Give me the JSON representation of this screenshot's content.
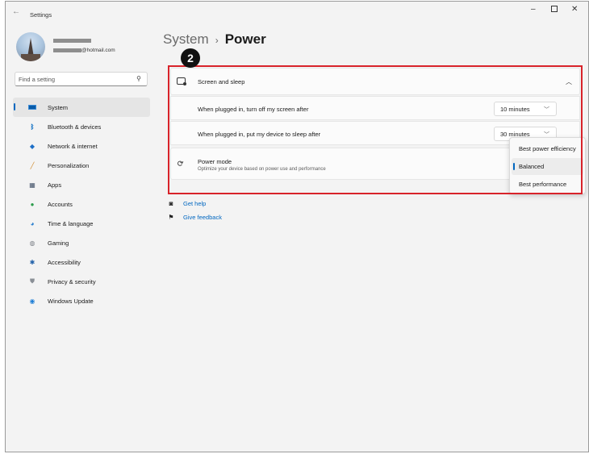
{
  "window": {
    "title": "Settings"
  },
  "user": {
    "email_suffix": "@hotmail.com"
  },
  "search": {
    "placeholder": "Find a setting"
  },
  "nav": [
    {
      "label": "System",
      "icon": "monitor-icon",
      "active": true
    },
    {
      "label": "Bluetooth & devices",
      "icon": "bluetooth-icon"
    },
    {
      "label": "Network & internet",
      "icon": "wifi-icon"
    },
    {
      "label": "Personalization",
      "icon": "brush-icon"
    },
    {
      "label": "Apps",
      "icon": "apps-icon"
    },
    {
      "label": "Accounts",
      "icon": "person-icon"
    },
    {
      "label": "Time & language",
      "icon": "globe-clock-icon"
    },
    {
      "label": "Gaming",
      "icon": "gamepad-icon"
    },
    {
      "label": "Accessibility",
      "icon": "accessibility-icon"
    },
    {
      "label": "Privacy & security",
      "icon": "shield-icon"
    },
    {
      "label": "Windows Update",
      "icon": "update-icon"
    }
  ],
  "breadcrumb": {
    "parent": "System",
    "separator": "›",
    "current": "Power"
  },
  "step_badge": "2",
  "screen_sleep": {
    "title": "Screen and sleep",
    "plugged_screen_label": "When plugged in, turn off my screen after",
    "plugged_screen_value": "10 minutes",
    "plugged_sleep_label": "When plugged in, put my device to sleep after",
    "plugged_sleep_value": "30 minutes"
  },
  "power_mode": {
    "title": "Power mode",
    "description": "Optimize your device based on power use and performance",
    "options": [
      "Best power efficiency",
      "Balanced",
      "Best performance"
    ],
    "selected": "Balanced"
  },
  "help": {
    "get_help": "Get help",
    "give_feedback": "Give feedback"
  },
  "colors": {
    "accent": "#0067c0",
    "highlight": "#d8232a"
  }
}
